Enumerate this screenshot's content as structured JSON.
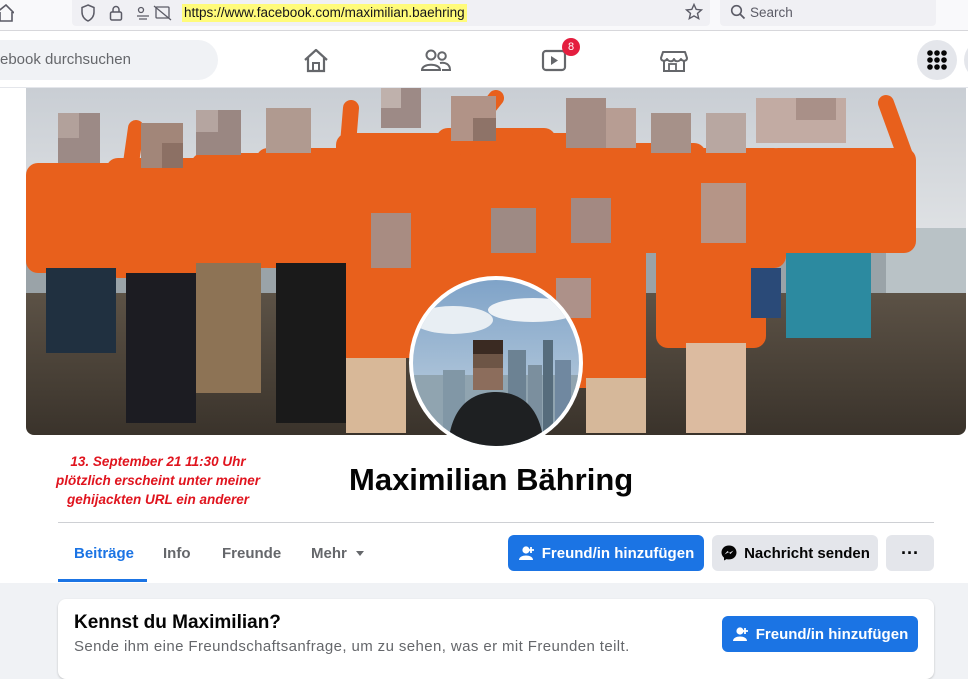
{
  "browser": {
    "url_prefix": "https://www.",
    "url_domain": "facebook.com",
    "url_path": "/maximilian.baehring",
    "search_placeholder": "Search",
    "icons": [
      "shield-icon",
      "lock-icon",
      "permissions-icon",
      "bookmark-star-icon",
      "search-icon"
    ]
  },
  "fbnav": {
    "search_placeholder": "ebook durchsuchen",
    "watch_badge": "8",
    "icons": [
      "home-icon",
      "friends-icon",
      "watch-icon",
      "marketplace-icon",
      "menu-grid-icon"
    ]
  },
  "profile": {
    "name": "Maximilian Bähring",
    "note": "13. September 21 11:30 Uhr\nplötzlich erscheint unter meiner\ngehijackten URL ein anderer",
    "tabs": [
      "Beiträge",
      "Info",
      "Freunde",
      "Mehr"
    ],
    "active_tab": "Beiträge",
    "add_friend_label": "Freund/in hinzufügen",
    "message_label": "Nachricht senden",
    "more_label": "···"
  },
  "know_card": {
    "title": "Kennst du Maximilian?",
    "text": "Sende ihm eine Freundschaftsanfrage, um zu sehen, was er mit Freunden teilt.",
    "add_friend_label": "Freund/in hinzufügen"
  },
  "colors": {
    "fb_blue": "#1b74e4",
    "note_red": "#e0141e",
    "url_highlight": "#fffb7a",
    "badge_red": "#e41e3f"
  }
}
